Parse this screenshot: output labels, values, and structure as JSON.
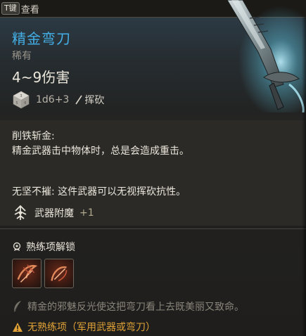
{
  "hint": {
    "key": "T键",
    "action": "查看"
  },
  "item": {
    "name": "精金弯刀",
    "rarity": "稀有",
    "damage": "4~9伤害",
    "dice_formula": "1d6+3",
    "damage_type_icon": "slash-icon",
    "damage_type": "挥砍"
  },
  "passive": {
    "title": "削铁斩金:",
    "description": "精金武器击中物体时，总是会造成重击。",
    "second": "无坚不摧: 这件武器可以无视挥砍抗性。",
    "enchant_label": "武器附魔",
    "enchant_value": "+1"
  },
  "proficiency": {
    "title": "熟练项解锁",
    "actions": [
      {
        "icon": "lacerate-action-icon"
      },
      {
        "icon": "flourish-action-icon"
      }
    ]
  },
  "flavor": "精金的邪魅反光使这把弯刀看上去既美丽又致命。",
  "warning": "无熟练项（军用武器或弯刀）",
  "colors": {
    "name": "#44aee6",
    "warning": "#e0a236",
    "enchant_value": "#b0a98e"
  }
}
